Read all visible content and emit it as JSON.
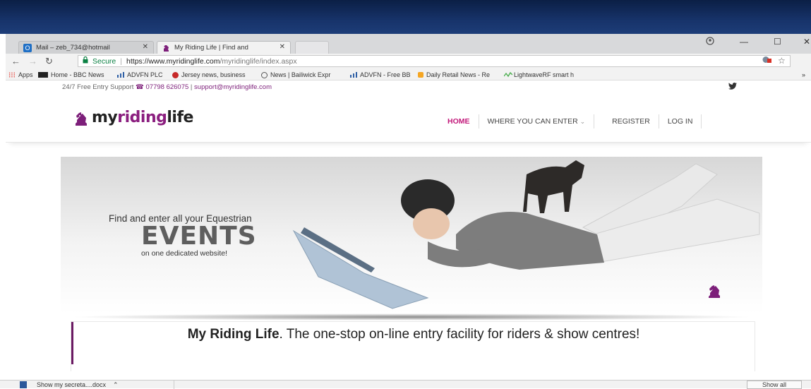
{
  "browser": {
    "tabs": [
      {
        "label": "Mail – zeb_734@hotmail",
        "icon": "outlook-icon"
      },
      {
        "label": "My Riding Life | Find and",
        "icon": "knight-icon"
      }
    ],
    "address": {
      "secure_label": "Secure",
      "url_host": "https://www.myridinglife.com",
      "url_path": "/myridinglife/index.aspx"
    },
    "bookmarks": [
      "Apps",
      "Home - BBC News",
      "ADVFN PLC",
      "Jersey news, business",
      "News | Bailiwick Expr",
      "ADVFN - Free BB",
      "Daily Retail News - Re",
      "LightwaveRF smart h"
    ]
  },
  "site": {
    "topbar": {
      "support": "24/7 Free Entry Support",
      "phone": "07798 626075",
      "separator": "|",
      "email": "support@myridinglife.com"
    },
    "logo": {
      "my": "my",
      "riding": "riding",
      "life": "life"
    },
    "menu": [
      "HOME",
      "WHERE YOU CAN ENTER",
      "REGISTER",
      "LOG IN"
    ],
    "hero": {
      "line1": "Find and enter all your Equestrian",
      "line2": "EVENTS",
      "line3": "on one dedicated website!"
    },
    "promo": {
      "bold": "My Riding Life",
      "rest": ". The one-stop on-line entry facility for riders & show centres!"
    }
  },
  "downloads": {
    "file": "Show my secreta....docx",
    "show_all": "Show all"
  },
  "colors": {
    "brand_purple": "#8b1e7f",
    "menu_active": "#c2187a",
    "secure_green": "#0b8043"
  }
}
